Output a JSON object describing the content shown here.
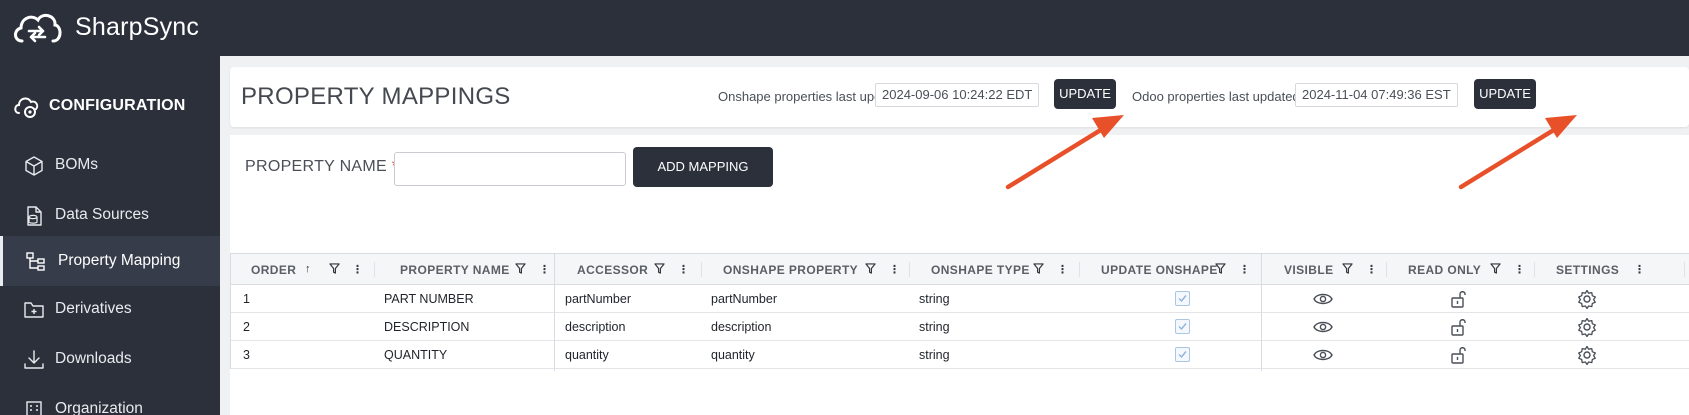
{
  "app": {
    "brand": "SharpSync"
  },
  "sidebar": {
    "header": {
      "label": "CONFIGURATION",
      "icon": "cloud-gear-icon"
    },
    "items": [
      {
        "label": "BOMs",
        "icon": "cube-icon",
        "active": false
      },
      {
        "label": "Data Sources",
        "icon": "database-file-icon",
        "active": false
      },
      {
        "label": "Property Mapping",
        "icon": "tree-diagram-icon",
        "active": true
      },
      {
        "label": "Derivatives",
        "icon": "folder-plus-icon",
        "active": false
      },
      {
        "label": "Downloads",
        "icon": "download-icon",
        "active": false
      },
      {
        "label": "Organization",
        "icon": "building-icon",
        "active": false
      }
    ]
  },
  "header": {
    "title": "PROPERTY MAPPINGS",
    "onshape_label": "Onshape properties last updated",
    "onshape_timestamp": "2024-09-06 10:24:22 EDT",
    "odoo_label": "Odoo properties last updated",
    "odoo_timestamp": "2024-11-04 07:49:36 EST",
    "update_label": "UPDATE"
  },
  "form": {
    "property_name_label": "PROPERTY NAME",
    "required_mark": "*",
    "property_name_value": "",
    "add_button": "ADD MAPPING"
  },
  "table": {
    "columns": [
      {
        "label": "ORDER",
        "sort": "asc"
      },
      {
        "label": "PROPERTY NAME"
      },
      {
        "label": "ACCESSOR"
      },
      {
        "label": "ONSHAPE PROPERTY"
      },
      {
        "label": "ONSHAPE TYPE"
      },
      {
        "label": "UPDATE ONSHAPE"
      },
      {
        "label": "VISIBLE"
      },
      {
        "label": "READ ONLY"
      },
      {
        "label": "SETTINGS"
      }
    ],
    "rows": [
      {
        "order": "1",
        "property_name": "PART NUMBER",
        "accessor": "partNumber",
        "onshape_property": "partNumber",
        "onshape_type": "string",
        "update_onshape": true
      },
      {
        "order": "2",
        "property_name": "DESCRIPTION",
        "accessor": "description",
        "onshape_property": "description",
        "onshape_type": "string",
        "update_onshape": true
      },
      {
        "order": "3",
        "property_name": "QUANTITY",
        "accessor": "quantity",
        "onshape_property": "quantity",
        "onshape_type": "string",
        "update_onshape": true
      }
    ]
  },
  "colors": {
    "dark": "#2b303b",
    "accent_arrow": "#e8502a",
    "required": "#e8502a"
  }
}
